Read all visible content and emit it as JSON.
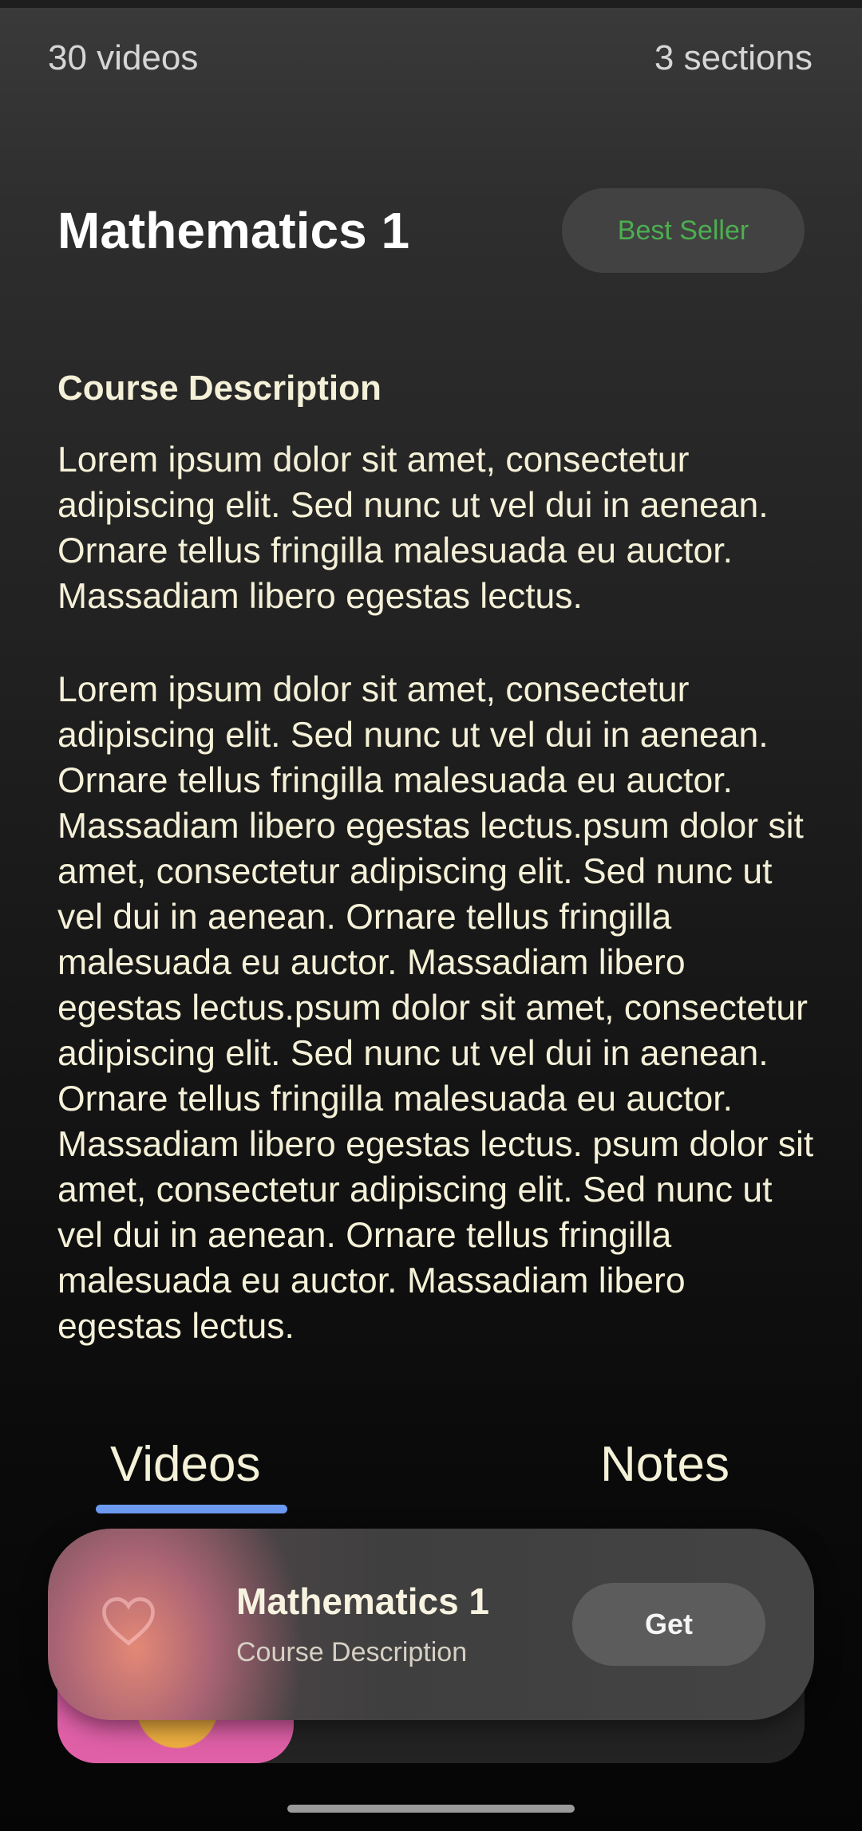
{
  "stats": {
    "videos": "30 videos",
    "sections": "3 sections"
  },
  "course": {
    "title": "Mathematics 1",
    "badge": "Best Seller"
  },
  "description": {
    "heading": "Course Description",
    "paragraph1": "Lorem ipsum dolor sit amet, consectetur adipiscing elit. Sed nunc ut vel dui in aenean. Ornare tellus fringilla malesuada eu auctor. Massadiam libero egestas lectus.",
    "paragraph2": "Lorem ipsum dolor sit amet, consectetur adipiscing elit. Sed nunc ut vel dui in aenean. Ornare tellus fringilla malesuada eu auctor. Massadiam libero egestas lectus.psum dolor sit amet, consectetur adipiscing elit. Sed nunc ut vel dui in aenean. Ornare tellus fringilla malesuada eu auctor. Massadiam libero egestas lectus.psum dolor sit amet, consectetur adipiscing elit. Sed nunc ut vel dui in aenean. Ornare tellus fringilla malesuada eu auctor. Massadiam libero egestas lectus. psum dolor sit amet, consectetur adipiscing elit. Sed nunc ut vel dui in aenean. Ornare tellus fringilla malesuada eu auctor. Massadiam libero egestas lectus."
  },
  "tabs": [
    {
      "label": "Videos",
      "active": true
    },
    {
      "label": "Notes",
      "active": false
    }
  ],
  "mini_player": {
    "title": "Mathematics 1",
    "subtitle": "Course Description",
    "button_label": "Get",
    "icon": "heart-icon"
  },
  "colors": {
    "accent": "#6d9bf2",
    "badge_text": "#4caf50",
    "text": "#f5f1d8",
    "thumbnail": "#e060a8"
  }
}
